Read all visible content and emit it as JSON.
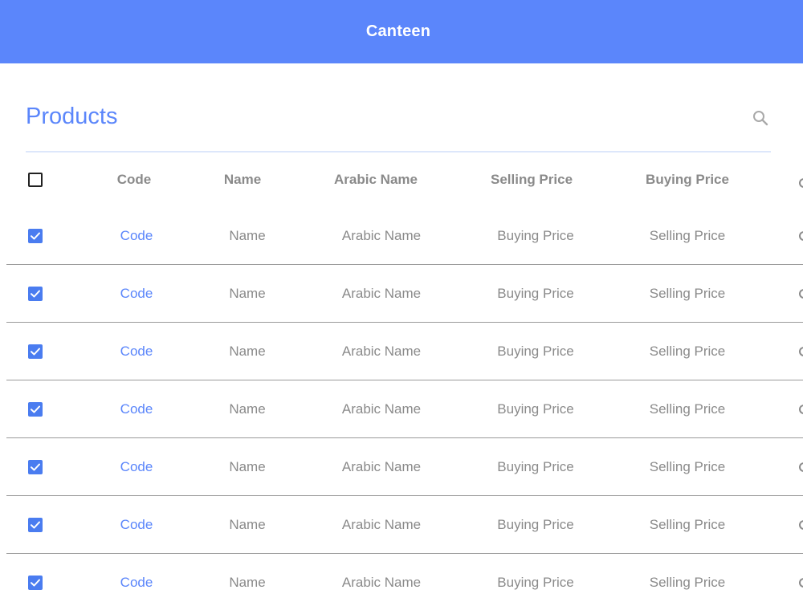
{
  "app": {
    "title": "Canteen"
  },
  "page": {
    "title": "Products"
  },
  "search": {
    "icon": "search-icon"
  },
  "colors": {
    "accent": "#5b86fb",
    "checkbox": "#4a7cf0",
    "muted_text": "#8a8a8a"
  },
  "table": {
    "headers": {
      "code": "Code",
      "name": "Name",
      "arabic_name": "Arabic Name",
      "selling_price": "Selling Price",
      "buying_price": "Buying Price"
    },
    "rows": [
      {
        "checked": true,
        "code": "Code",
        "name": "Name",
        "arabic_name": "Arabic Name",
        "col4": "Buying Price",
        "col5": "Selling Price"
      },
      {
        "checked": true,
        "code": "Code",
        "name": "Name",
        "arabic_name": "Arabic Name",
        "col4": "Buying Price",
        "col5": "Selling Price"
      },
      {
        "checked": true,
        "code": "Code",
        "name": "Name",
        "arabic_name": "Arabic Name",
        "col4": "Buying Price",
        "col5": "Selling Price"
      },
      {
        "checked": true,
        "code": "Code",
        "name": "Name",
        "arabic_name": "Arabic Name",
        "col4": "Buying Price",
        "col5": "Selling Price"
      },
      {
        "checked": true,
        "code": "Code",
        "name": "Name",
        "arabic_name": "Arabic Name",
        "col4": "Buying Price",
        "col5": "Selling Price"
      },
      {
        "checked": true,
        "code": "Code",
        "name": "Name",
        "arabic_name": "Arabic Name",
        "col4": "Buying Price",
        "col5": "Selling Price"
      },
      {
        "checked": true,
        "code": "Code",
        "name": "Name",
        "arabic_name": "Arabic Name",
        "col4": "Buying Price",
        "col5": "Selling Price"
      }
    ]
  }
}
